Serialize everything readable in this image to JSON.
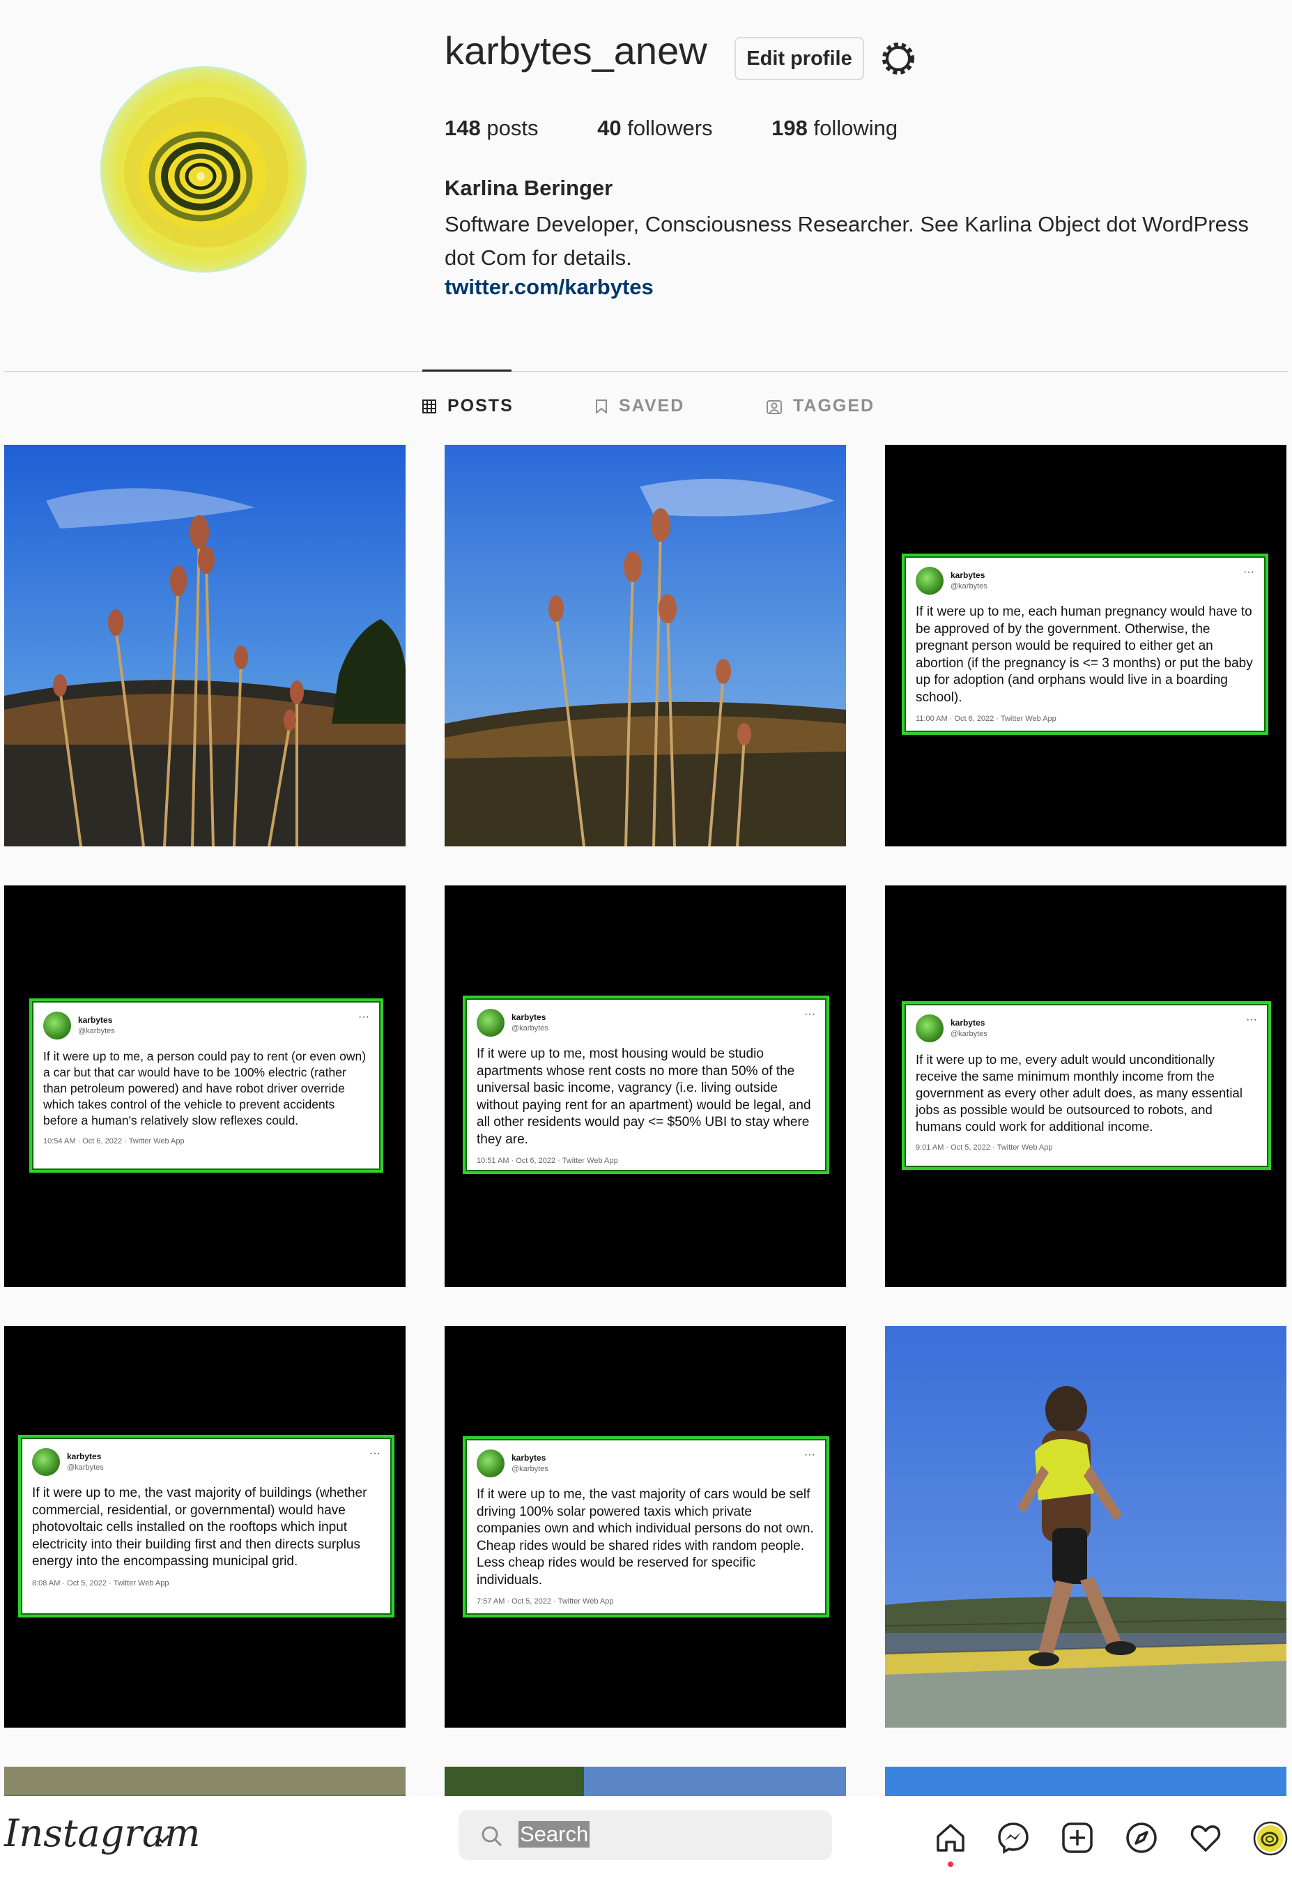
{
  "profile": {
    "username": "karbytes_anew",
    "edit_profile_label": "Edit profile",
    "posts_count": "148",
    "posts_label": "posts",
    "followers_count": "40",
    "followers_label": "followers",
    "following_count": "198",
    "following_label": "following",
    "full_name": "Karlina Beringer",
    "bio": "Software Developer, Consciousness Researcher. See Karlina Object dot WordPress dot Com for details.",
    "link": "twitter.com/karbytes"
  },
  "tabs": [
    {
      "label": "POSTS",
      "active": true,
      "icon": "grid-icon"
    },
    {
      "label": "SAVED",
      "active": false,
      "icon": "bookmark-icon"
    },
    {
      "label": "TAGGED",
      "active": false,
      "icon": "tagged-icon"
    }
  ],
  "tweets": [
    {
      "name": "karbytes",
      "handle": "@karbytes",
      "text": "If it were up to me, each human pregnancy would have to be approved of by the government. Otherwise, the pregnant person would be required to either get an abortion (if the pregnancy is <= 3 months) or put the baby up for adoption (and orphans would live in a boarding school).",
      "meta": "11:00 AM · Oct 6, 2022 · Twitter Web App"
    },
    {
      "name": "karbytes",
      "handle": "@karbytes",
      "text": "If it were up to me, a person could pay to rent (or even own) a car but that car would have to be 100% electric (rather than petroleum powered) and have robot driver override which takes control of the vehicle to prevent accidents before a human's relatively slow reflexes could.",
      "meta": "10:54 AM · Oct 6, 2022 · Twitter Web App"
    },
    {
      "name": "karbytes",
      "handle": "@karbytes",
      "text": "If it were up to me, most housing would be studio apartments whose rent costs no more than 50% of the universal basic income, vagrancy (i.e. living outside without paying rent for an apartment) would be legal, and all other residents would pay <= $50% UBI to stay where they are.",
      "meta": "10:51 AM · Oct 6, 2022 · Twitter Web App"
    },
    {
      "name": "karbytes",
      "handle": "@karbytes",
      "text": "If it were up to me, every adult would unconditionally receive the same minimum monthly income from the government as every other adult does, as many essential jobs as possible would be outsourced to robots, and humans could work for additional income.",
      "meta": "9:01 AM · Oct 5, 2022 · Twitter Web App"
    },
    {
      "name": "karbytes",
      "handle": "@karbytes",
      "text": "If it were up to me, the vast majority of buildings (whether commercial, residential, or governmental) would have photovoltaic cells installed on the rooftops which input electricity into their building first and then directs surplus energy into the encompassing municipal grid.",
      "meta": "8:08 AM · Oct 5, 2022 · Twitter Web App"
    },
    {
      "name": "karbytes",
      "handle": "@karbytes",
      "text": "If it were up to me, the vast majority of cars would be self driving 100% solar powered taxis which private companies own and which individual persons do not own. Cheap rides would be shared rides with random people. Less cheap rides would be reserved for specific individuals.",
      "meta": "7:57 AM · Oct 5, 2022 · Twitter Web App"
    }
  ],
  "nav": {
    "logo": "Instagram",
    "search_placeholder": "Search",
    "icons": [
      "home-icon",
      "messenger-icon",
      "new-post-icon",
      "explore-icon",
      "heart-icon",
      "profile-avatar"
    ]
  },
  "colors": {
    "tweet_border": "#2fd12a",
    "link": "#00376b",
    "notification": "#ff3040"
  }
}
